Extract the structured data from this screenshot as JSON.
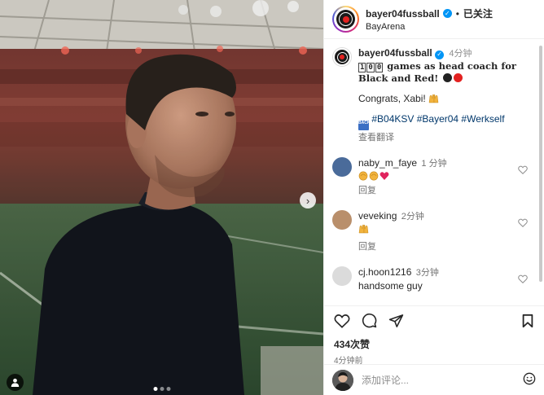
{
  "header": {
    "username": "bayer04fussball",
    "separator": "•",
    "following_label": "已关注",
    "location": "BayArena"
  },
  "caption": {
    "username": "bayer04fussball",
    "time": "4分钟",
    "keycap_1": "1",
    "keycap_2": "0",
    "keycap_3": "0",
    "headline_rest": " games as head coach for Black and Red!",
    "congrats": "Congrats, Xabi!",
    "hashtags": "#B04KSV #Bayer04 #Werkself",
    "back_label": "BACK",
    "see_translation": "查看翻译"
  },
  "comments": [
    {
      "username": "naby_m_faye",
      "time": "1 分钟",
      "text": "",
      "reply": "回复",
      "avatar_color": "#3f5c8a"
    },
    {
      "username": "veveking",
      "time": "2分钟",
      "text": "",
      "reply": "回复",
      "avatar_color": "#b98f6b"
    },
    {
      "username": "cj.hoon1216",
      "time": "3分钟",
      "text": "handsome guy",
      "reply": "",
      "avatar_color": "#d9d9d9"
    }
  ],
  "actions": {
    "likes": "434次赞",
    "posted": "4分钟前"
  },
  "add_comment": {
    "placeholder": "添加评论..."
  },
  "media": {
    "next_label": "›",
    "carousel_count": 3,
    "carousel_active_index": 0
  },
  "colors": {
    "verified": "#0095f6",
    "club_red": "#e32221",
    "hashtag": "#00376b"
  }
}
